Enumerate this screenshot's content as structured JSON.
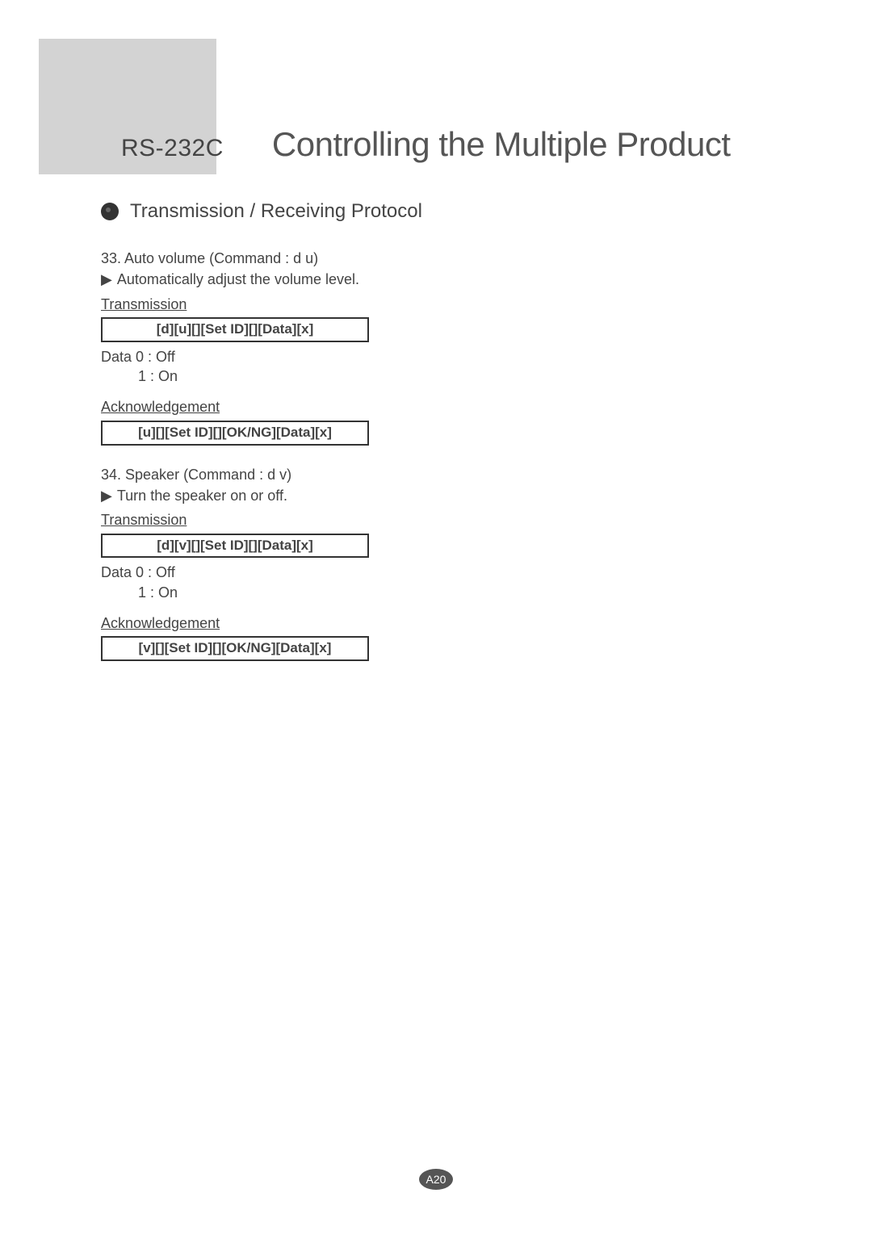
{
  "header": {
    "label": "RS-232C",
    "title": "Controlling the Multiple Product"
  },
  "section": {
    "title": "Transmission / Receiving Protocol"
  },
  "commands": [
    {
      "title": "33. Auto volume (Command : d u)",
      "description": "Automatically adjust the volume level.",
      "transmission_label": "Transmission",
      "transmission_protocol": "[d][u][][Set ID][][Data][x]",
      "data_lines": [
        "Data 0 : Off",
        "1 : On"
      ],
      "ack_label": "Acknowledgement",
      "ack_protocol": "[u][][Set ID][][OK/NG][Data][x]"
    },
    {
      "title": "34. Speaker (Command : d v)",
      "description": "Turn the speaker on or off.",
      "transmission_label": "Transmission",
      "transmission_protocol": "[d][v][][Set ID][][Data][x]",
      "data_lines": [
        "Data 0 : Off",
        "1 : On"
      ],
      "ack_label": "Acknowledgement",
      "ack_protocol": "[v][][Set ID][][OK/NG][Data][x]"
    }
  ],
  "page_number": "A20",
  "glyphs": {
    "arrow": "▶"
  }
}
